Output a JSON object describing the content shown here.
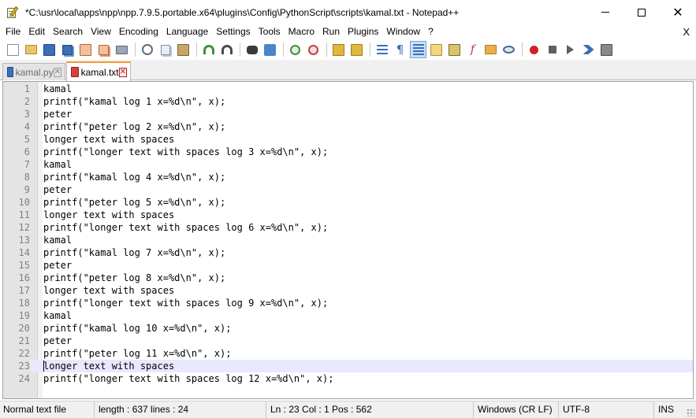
{
  "window": {
    "title": "*C:\\usr\\local\\apps\\npp\\npp.7.9.5.portable.x64\\plugins\\Config\\PythonScript\\scripts\\kamal.txt - Notepad++"
  },
  "menu": {
    "items": [
      "File",
      "Edit",
      "Search",
      "View",
      "Encoding",
      "Language",
      "Settings",
      "Tools",
      "Macro",
      "Run",
      "Plugins",
      "Window",
      "?"
    ],
    "close_label": "X"
  },
  "toolbar": {
    "icons": [
      "new-file-icon",
      "open-file-icon",
      "save-icon",
      "save-all-icon",
      "close-icon",
      "close-all-icon",
      "print-icon",
      "cut-icon",
      "copy-icon",
      "paste-icon",
      "undo-icon",
      "redo-icon",
      "find-icon",
      "replace-icon",
      "zoom-in-icon",
      "zoom-out-icon",
      "sync-scroll-icon",
      "word-wrap-icon",
      "show-all-chars-icon",
      "indent-guide-icon",
      "user-defined-language-icon",
      "document-map-icon",
      "function-list-icon",
      "folder-as-workspace-icon",
      "monitoring-icon",
      "record-macro-icon",
      "stop-recording-icon",
      "playback-macro-icon",
      "run-macro-multiple-icon",
      "save-macro-icon"
    ]
  },
  "tabs": [
    {
      "label": "kamal.py",
      "active": false
    },
    {
      "label": "kamal.txt",
      "active": true
    }
  ],
  "editor": {
    "current_line": 23,
    "lines": [
      {
        "num": "1",
        "text": "kamal"
      },
      {
        "num": "2",
        "text": "printf(\"kamal log 1 x=%d\\n\", x);"
      },
      {
        "num": "3",
        "text": "peter"
      },
      {
        "num": "4",
        "text": "printf(\"peter log 2 x=%d\\n\", x);"
      },
      {
        "num": "5",
        "text": "longer text with spaces"
      },
      {
        "num": "6",
        "text": "printf(\"longer text with spaces log 3 x=%d\\n\", x);"
      },
      {
        "num": "7",
        "text": "kamal"
      },
      {
        "num": "8",
        "text": "printf(\"kamal log 4 x=%d\\n\", x);"
      },
      {
        "num": "9",
        "text": "peter"
      },
      {
        "num": "10",
        "text": "printf(\"peter log 5 x=%d\\n\", x);"
      },
      {
        "num": "11",
        "text": "longer text with spaces"
      },
      {
        "num": "12",
        "text": "printf(\"longer text with spaces log 6 x=%d\\n\", x);"
      },
      {
        "num": "13",
        "text": "kamal"
      },
      {
        "num": "14",
        "text": "printf(\"kamal log 7 x=%d\\n\", x);"
      },
      {
        "num": "15",
        "text": "peter"
      },
      {
        "num": "16",
        "text": "printf(\"peter log 8 x=%d\\n\", x);"
      },
      {
        "num": "17",
        "text": "longer text with spaces"
      },
      {
        "num": "18",
        "text": "printf(\"longer text with spaces log 9 x=%d\\n\", x);"
      },
      {
        "num": "19",
        "text": "kamal"
      },
      {
        "num": "20",
        "text": "printf(\"kamal log 10 x=%d\\n\", x);"
      },
      {
        "num": "21",
        "text": "peter"
      },
      {
        "num": "22",
        "text": "printf(\"peter log 11 x=%d\\n\", x);"
      },
      {
        "num": "23",
        "text": "longer text with spaces"
      },
      {
        "num": "24",
        "text": "printf(\"longer text with spaces log 12 x=%d\\n\", x);"
      }
    ]
  },
  "status": {
    "file_type": "Normal text file",
    "length_lines": "length : 637    lines : 24",
    "position": "Ln : 23    Col : 1    Pos : 562",
    "eol": "Windows (CR LF)",
    "encoding": "UTF-8",
    "mode": "INS"
  }
}
